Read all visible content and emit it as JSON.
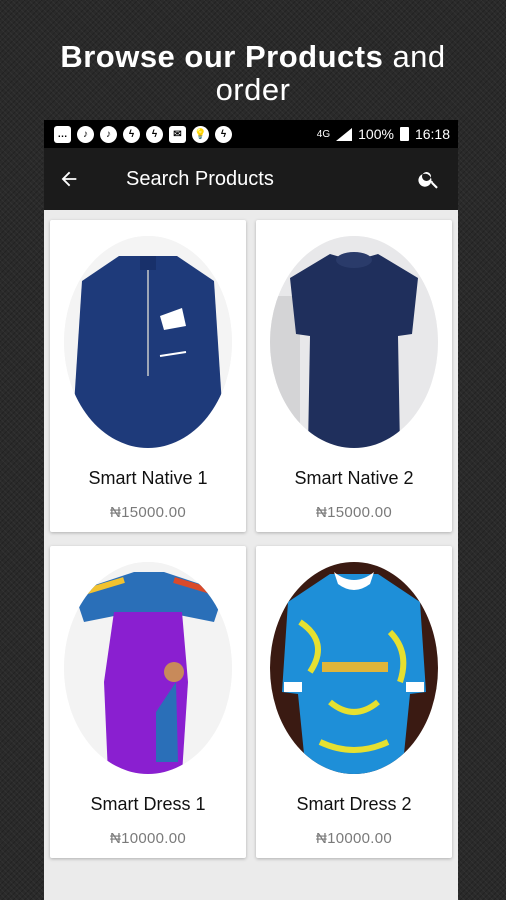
{
  "promo": {
    "headline_bold": "Browse our Products",
    "headline_light1": "and",
    "headline_light2": "order"
  },
  "status_bar": {
    "battery": "100%",
    "time": "16:18",
    "network": "4G"
  },
  "app_bar": {
    "title": "Search Products"
  },
  "products": [
    {
      "name": "Smart Native 1",
      "price": "₦15000.00"
    },
    {
      "name": "Smart Native 2",
      "price": "₦15000.00"
    },
    {
      "name": "Smart Dress 1",
      "price": "₦10000.00"
    },
    {
      "name": "Smart Dress 2",
      "price": "₦10000.00"
    }
  ],
  "colors": {
    "app_bar": "#1b1b1b",
    "status_bar": "#000000",
    "background": "#ebebeb"
  }
}
